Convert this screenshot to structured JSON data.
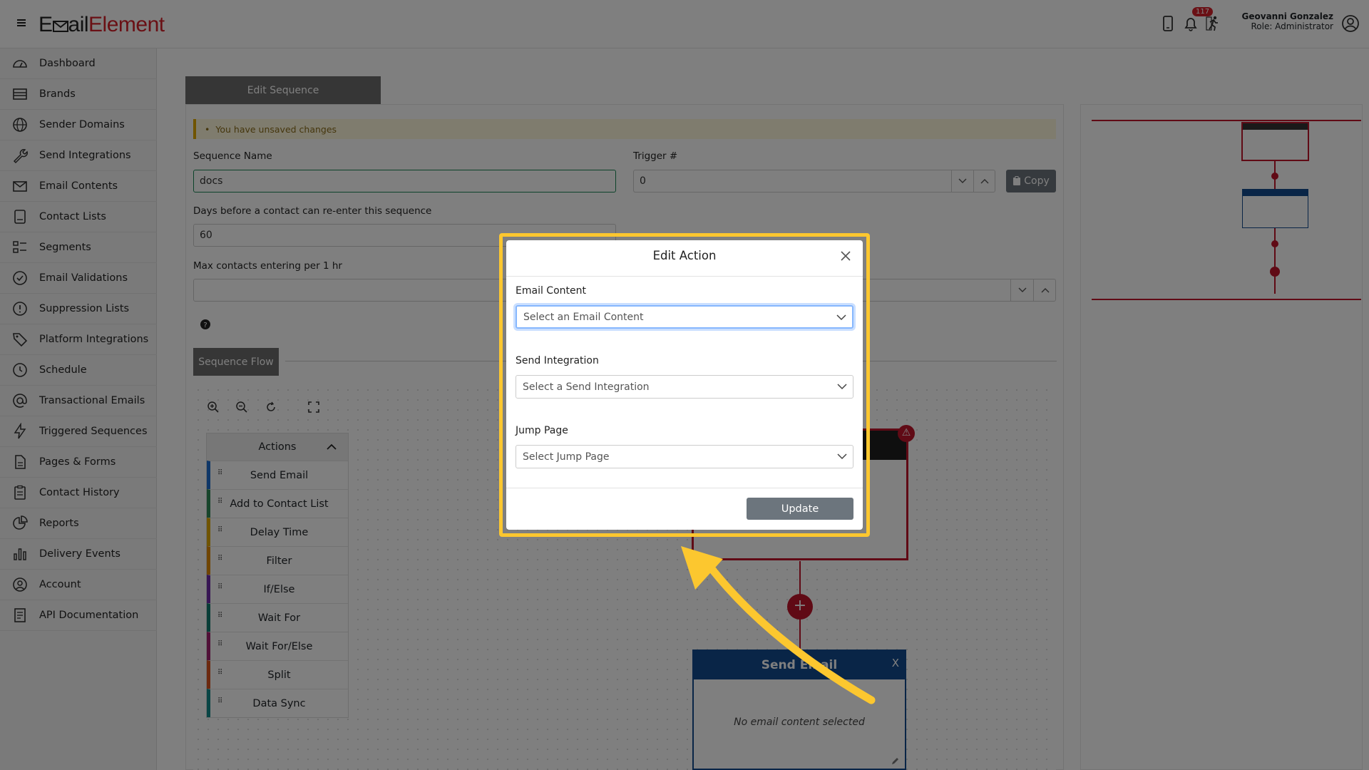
{
  "brand": {
    "logo_part1": "E",
    "logo_part2": "ail",
    "logo_part3": "Element"
  },
  "header": {
    "notification_count": "117",
    "user_name": "Geovanni Gonzalez",
    "user_role": "Role: Administrator"
  },
  "sidebar": {
    "items": [
      {
        "label": "Dashboard",
        "icon": "dashboard-icon"
      },
      {
        "label": "Brands",
        "icon": "brands-icon"
      },
      {
        "label": "Sender Domains",
        "icon": "globe-icon"
      },
      {
        "label": "Send Integrations",
        "icon": "wrench-icon"
      },
      {
        "label": "Email Contents",
        "icon": "envelope-icon"
      },
      {
        "label": "Contact Lists",
        "icon": "list-icon"
      },
      {
        "label": "Segments",
        "icon": "segments-icon"
      },
      {
        "label": "Email Validations",
        "icon": "check-circle-icon"
      },
      {
        "label": "Suppression Lists",
        "icon": "exclamation-circle-icon"
      },
      {
        "label": "Platform Integrations",
        "icon": "tag-icon"
      },
      {
        "label": "Schedule",
        "icon": "clock-icon"
      },
      {
        "label": "Transactional Emails",
        "icon": "at-icon"
      },
      {
        "label": "Triggered Sequences",
        "icon": "lightning-icon"
      },
      {
        "label": "Pages & Forms",
        "icon": "file-icon"
      },
      {
        "label": "Contact History",
        "icon": "clipboard-icon"
      },
      {
        "label": "Reports",
        "icon": "pie-chart-icon"
      },
      {
        "label": "Delivery Events",
        "icon": "bar-chart-icon"
      },
      {
        "label": "Account",
        "icon": "user-circle-icon"
      },
      {
        "label": "API Documentation",
        "icon": "document-icon"
      }
    ]
  },
  "page": {
    "tab_label": "Edit Sequence",
    "unsaved_notice": "You have unsaved changes",
    "sequence_name_label": "Sequence Name",
    "sequence_name_value": "docs",
    "trigger_label": "Trigger #",
    "trigger_value": "0",
    "copy_label": "Copy",
    "reenter_label": "Days before a contact can re-enter this sequence",
    "reenter_value": "60",
    "max_contacts_label": "Max contacts entering per 1 hr",
    "max_contacts_value": "",
    "sequence_flow_label": "Sequence Flow"
  },
  "actions_panel": {
    "title": "Actions",
    "items": [
      {
        "label": "Send Email",
        "color": "#1f6fd1"
      },
      {
        "label": "Add to Contact List",
        "color": "#2e8b57"
      },
      {
        "label": "Delay Time",
        "color": "#e0a800"
      },
      {
        "label": "Filter",
        "color": "#e08a00"
      },
      {
        "label": "If/Else",
        "color": "#6f2da8"
      },
      {
        "label": "Wait For",
        "color": "#137b6e"
      },
      {
        "label": "Wait For/Else",
        "color": "#a0206e"
      },
      {
        "label": "Split",
        "color": "#d9531e"
      },
      {
        "label": "Data Sync",
        "color": "#138a8a"
      }
    ]
  },
  "flow": {
    "node2_title": "Send Email",
    "node2_close": "X",
    "node2_body": "No email content selected"
  },
  "modal": {
    "title": "Edit Action",
    "email_content_label": "Email Content",
    "email_content_placeholder": "Select an Email Content",
    "send_integration_label": "Send Integration",
    "send_integration_placeholder": "Select a Send Integration",
    "jump_page_label": "Jump Page",
    "jump_page_placeholder": "Select Jump Page",
    "update_label": "Update"
  },
  "colors": {
    "brand_red": "#d4202a",
    "highlight": "#fcc72f",
    "send_email_blue": "#124b8f"
  }
}
